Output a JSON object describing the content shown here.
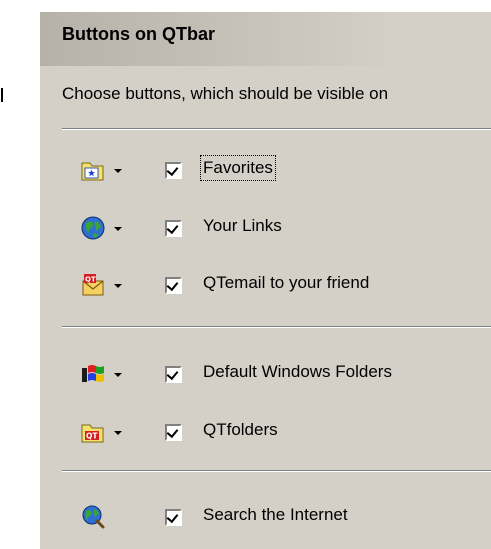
{
  "header": {
    "title": "Buttons on QTbar"
  },
  "subtitle": "Choose buttons, which should be visible on",
  "groups": [
    {
      "items": [
        {
          "label": "Favorites",
          "checked": true,
          "icon": "favorites-folder-icon",
          "has_dropdown": true,
          "focused": true
        },
        {
          "label": "Your Links",
          "checked": true,
          "icon": "globe-links-icon",
          "has_dropdown": true
        },
        {
          "label": "QTemail to your friend",
          "checked": true,
          "icon": "qtemail-icon",
          "has_dropdown": true
        }
      ]
    },
    {
      "items": [
        {
          "label": "Default Windows Folders",
          "checked": true,
          "icon": "windows-folders-icon",
          "has_dropdown": true
        },
        {
          "label": "QTfolders",
          "checked": true,
          "icon": "qt-folder-icon",
          "has_dropdown": true
        }
      ]
    },
    {
      "items": [
        {
          "label": "Search the Internet",
          "checked": true,
          "icon": "search-globe-icon",
          "has_dropdown": false
        }
      ]
    }
  ],
  "colors": {
    "panel": "#d4d0c8",
    "header": "#b6b2aa",
    "shadow": "#808080"
  }
}
